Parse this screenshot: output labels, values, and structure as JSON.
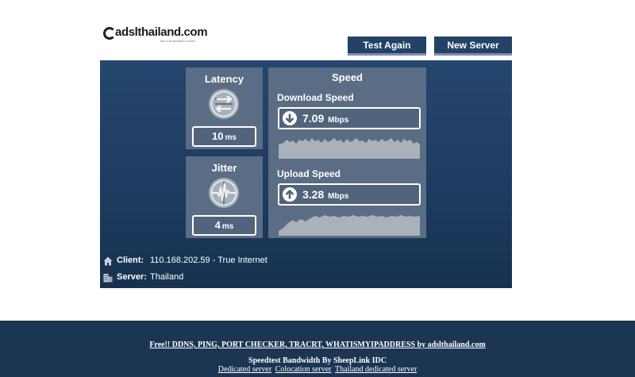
{
  "logo": {
    "text": "adslthailand.com",
    "tagline": "fast a Broadband Choice"
  },
  "toolbar": {
    "test_again_label": "Test Again",
    "new_server_label": "New Server"
  },
  "latency": {
    "title": "Latency",
    "value": "10",
    "unit": "ms",
    "icon": "arrows-swap-icon"
  },
  "jitter": {
    "title": "Jitter",
    "value": "4",
    "unit": "ms",
    "icon": "waveform-icon"
  },
  "speed": {
    "title": "Speed",
    "download": {
      "label": "Download Speed",
      "value": "7.09",
      "unit": "Mbps",
      "icon": "arrow-down-icon"
    },
    "upload": {
      "label": "Upload Speed",
      "value": "3.28",
      "unit": "Mbps",
      "icon": "arrow-up-icon"
    }
  },
  "info": {
    "client_label": "Client:",
    "client_value": "110.168.202.59 - True Internet",
    "server_label": "Server:",
    "server_value": "Thailand"
  },
  "footer": {
    "tools_link": "Free!! DDNS, PING, PORT CHECKER, TRACRT, WHATISMYIPADDRESS by adslthailand.com",
    "credit": "Speedtest Bandwidth By SheepLink IDC",
    "links": [
      "Dedicated server",
      "Colocation server",
      "Thailand dedicated server"
    ]
  },
  "colors": {
    "panel_bg": "#1d3c61",
    "card_bg": "#5a6d84",
    "button_bg": "#234266",
    "footer_bg": "#1b3553",
    "graph_fill": "#a9b1bb"
  }
}
